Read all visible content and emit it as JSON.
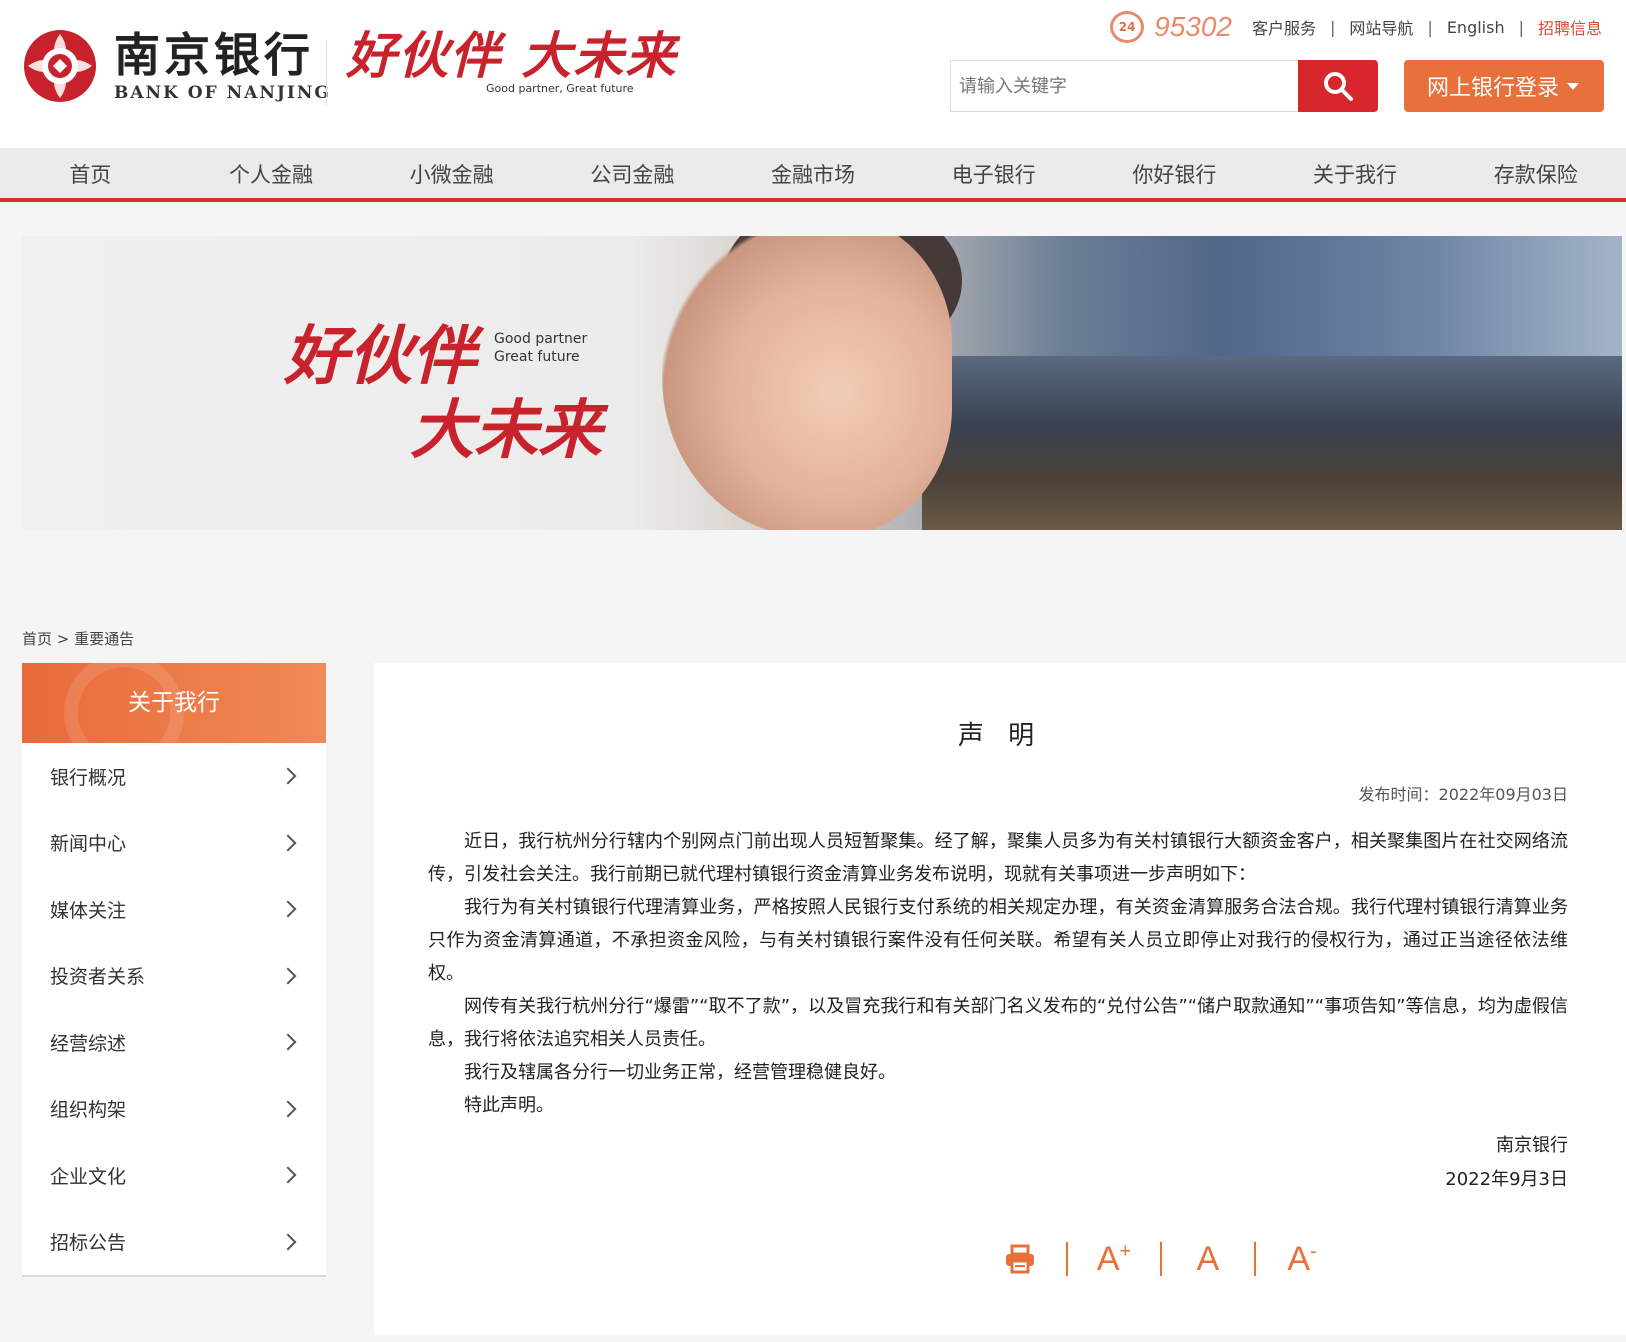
{
  "header": {
    "logo_cn": "南京银行",
    "logo_en": "BANK OF NANJING",
    "slogan_cn": "好伙伴 大未来",
    "slogan_en": "Good partner, Great future",
    "hotline_badge": "24",
    "hotline": "95302",
    "links": [
      "客户服务",
      "网站导航",
      "English",
      "招聘信息"
    ],
    "search_placeholder": "请输入关键字",
    "login_label": "网上银行登录",
    "accent": "#d7262c",
    "orange": "#e8703a"
  },
  "nav": [
    "首页",
    "个人金融",
    "小微金融",
    "公司金融",
    "金融市场",
    "电子银行",
    "你好银行",
    "关于我行",
    "存款保险"
  ],
  "banner": {
    "slogan_line1": "好伙伴",
    "slogan_line2": "大未来",
    "en_line1": "Good partner",
    "en_line2": "Great future"
  },
  "breadcrumb": "首页 > 重要通告",
  "sidebar": {
    "title": "关于我行",
    "items": [
      "银行概况",
      "新闻中心",
      "媒体关注",
      "投资者关系",
      "经营综述",
      "组织构架",
      "企业文化",
      "招标公告"
    ]
  },
  "article": {
    "title": "声 明",
    "pub_time": "发布时间：2022年09月03日",
    "paragraphs": [
      "近日，我行杭州分行辖内个别网点门前出现人员短暂聚集。经了解，聚集人员多为有关村镇银行大额资金客户，相关聚集图片在社交网络流传，引发社会关注。我行前期已就代理村镇银行资金清算业务发布说明，现就有关事项进一步声明如下：",
      "我行为有关村镇银行代理清算业务，严格按照人民银行支付系统的相关规定办理，有关资金清算服务合法合规。我行代理村镇银行清算业务只作为资金清算通道，不承担资金风险，与有关村镇银行案件没有任何关联。希望有关人员立即停止对我行的侵权行为，通过正当途径依法维权。",
      "网传有关我行杭州分行“爆雷”“取不了款”，以及冒充我行和有关部门名义发布的“兑付公告”“储户取款通知”“事项告知”等信息，均为虚假信息，我行将依法追究相关人员责任。",
      "我行及辖属各分行一切业务正常，经营管理稳健良好。",
      "特此声明。"
    ],
    "signature": "南京银行",
    "date": "2022年9月3日"
  },
  "tools": {
    "font_a": "A",
    "plus": "+",
    "minus": "-"
  }
}
